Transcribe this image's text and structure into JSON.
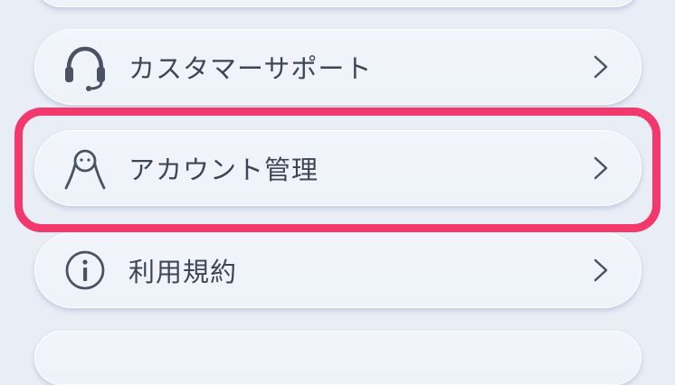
{
  "menu": {
    "items": [
      {
        "label": "カスタマーサポート",
        "icon": "headset-icon"
      },
      {
        "label": "アカウント管理",
        "icon": "person-icon"
      },
      {
        "label": "利用規約",
        "icon": "info-icon"
      }
    ]
  },
  "colors": {
    "background": "#e9eef6",
    "card": "#f0f4fa",
    "text": "#3d4657",
    "highlight": "#f2386c"
  }
}
